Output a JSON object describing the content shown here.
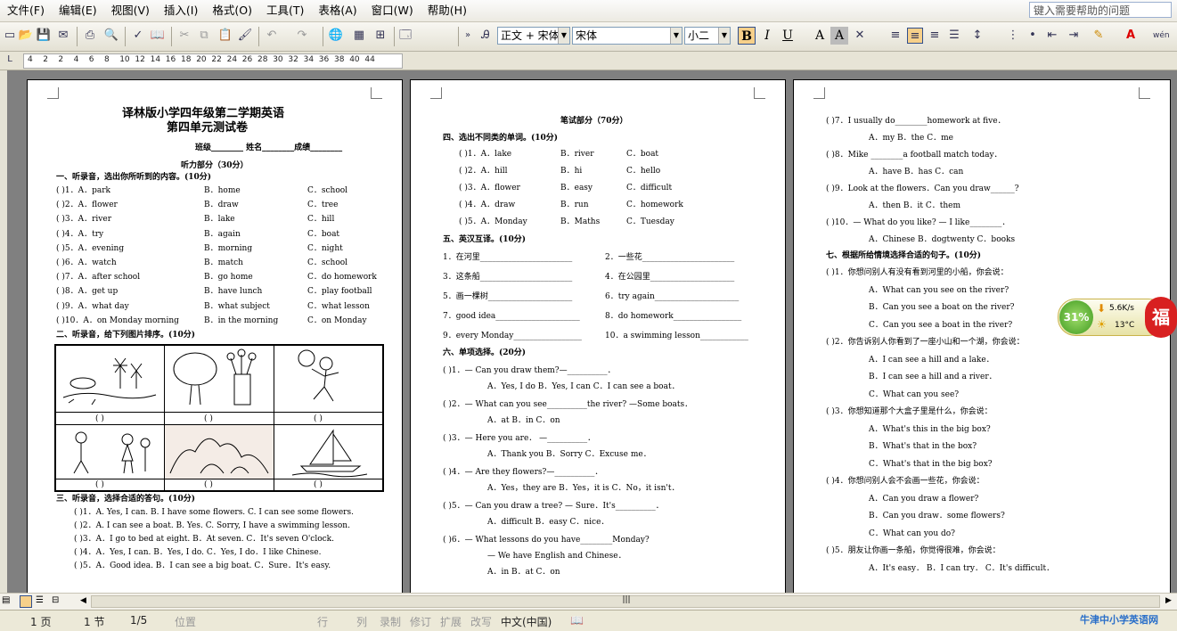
{
  "menu": [
    "文件(F)",
    "编辑(E)",
    "视图(V)",
    "插入(I)",
    "格式(O)",
    "工具(T)",
    "表格(A)",
    "窗口(W)",
    "帮助(H)"
  ],
  "help_placeholder": "键入需要帮助的问题",
  "toolbar": {
    "style_value": "正文 + 宋体",
    "font_value": "宋体",
    "size_value": "小二",
    "bold": "B",
    "italic": "I",
    "underline": "U",
    "char_a": "A",
    "char_a2": "A",
    "pinyin": "wén"
  },
  "ruler_ticks": [
    "4",
    "2",
    "2",
    "4",
    "6",
    "8",
    "10",
    "12",
    "14",
    "16",
    "18",
    "20",
    "22",
    "24",
    "26",
    "28",
    "30",
    "32",
    "34",
    "36",
    "38",
    "40",
    "44"
  ],
  "page1": {
    "title_line1": "译林版小学四年级第二学期英语",
    "title_line2": "第四单元测试卷",
    "info": "班级________ 姓名________成绩________",
    "listen_section": "听力部分（30分）",
    "sec1": "一、听录音，选出你所听到的内容。(10分)",
    "sec1_items": [
      [
        "(    )1．A．park",
        "B．home",
        "C．school"
      ],
      [
        "(    )2．A．flower",
        "B．draw",
        "C．tree"
      ],
      [
        "(    )3．A．river",
        "B．lake",
        "C．hill"
      ],
      [
        "(    )4．A．try",
        "B．again",
        "C．boat"
      ],
      [
        "(    )5．A．evening",
        "B．morning",
        "C．night"
      ],
      [
        "(    )6．A．watch",
        "B．match",
        "C．school"
      ],
      [
        "(    )7．A．after school",
        "B．go home",
        "C．do homework"
      ],
      [
        "(    )8．A．get up",
        "B．have lunch",
        "C．play football"
      ],
      [
        "(    )9．A．what day",
        "B．what subject",
        "C．what lesson"
      ],
      [
        "(    )10．A．on Monday morning",
        "B．in the morning",
        "C．on Monday"
      ]
    ],
    "sec2": "二、听录音，给下列图片排序。(10分)",
    "pic_blank": "(      )",
    "sec3": "三、听录音，选择合适的答句。(10分)",
    "sec3_items": [
      "(    )1．A. Yes, I can.      B. I have some flowers.   C.    I can see some flowers.",
      "(    )2．A. I can see a boat.    B. Yes.       C. Sorry, I have a swimming lesson.",
      "(    )3．A．I go to bed at eight.    B．At seven.    C．It's seven O'clock.",
      "(    )4．A．Yes, I can.    B．Yes, I do.    C．Yes, I do．I like Chinese.",
      "(    )5．A．Good idea.    B．I can see a big boat.    C．Sure．It's easy."
    ]
  },
  "page2": {
    "written_section": "笔试部分（70分）",
    "sec4": "四、选出不同类的单词。(10分)",
    "sec4_items": [
      [
        "(    )1．A．lake",
        "B．river",
        "C．boat"
      ],
      [
        "(    )2．A．hill",
        "B．hi",
        "C．hello"
      ],
      [
        "(    )3．A．flower",
        "B．easy",
        "C．difficult"
      ],
      [
        "(    )4．A．draw",
        "B．run",
        "C．homework"
      ],
      [
        "(    )5．A．Monday",
        "B．Maths",
        "C．Tuesday"
      ]
    ],
    "sec5": "五、英汉互译。(10分)",
    "sec5_items": [
      [
        "1．在河里_______________________",
        "2．一些花_______________________"
      ],
      [
        "3．这条船_______________________",
        "4．在公园里_____________________"
      ],
      [
        "5．画一棵树_____________________",
        "6．try again_____________________"
      ],
      [
        "7．good idea_____________________",
        "8．do homework_________________"
      ],
      [
        "9．every Monday_________________",
        "10．a swimming lesson____________"
      ]
    ],
    "sec6": "六、单项选择。(20分)",
    "sec6_items": [
      [
        "(    )1．— Can you draw them?—__________．",
        "A．Yes, I do      B．Yes, I can      C．I can see a boat．"
      ],
      [
        "(    )2．— What can you see__________the river?      —Some boats．",
        "A．at              B．in              C．on"
      ],
      [
        "(    )3．— Here you are．  —__________．",
        "A．Thank you       B．Sorry           C．Excuse me．"
      ],
      [
        "(    )4．— Are they flowers?—__________．",
        "A．Yes，they are    B．Yes，it is  C．No，it isn't．"
      ],
      [
        "(    )5．— Can you draw a tree?  — Sure．It's__________．",
        "A．difficult        B．easy            C．nice．"
      ],
      [
        "(    )6．— What lessons do you have________Monday?",
        "— We have English and Chinese．"
      ]
    ],
    "sec6_last": "A．in              B．at              C．on"
  },
  "page3": {
    "items": [
      [
        "(    )7．I usually do________homework at five．",
        "A．my          B．the          C．me"
      ],
      [
        "(    )8．Mike ________a football match today．",
        "A．have        B．has          C．can"
      ],
      [
        "(    )9．Look at the flowers．Can you draw______?",
        "A．then        B．it           C．them"
      ],
      [
        "(    )10．— What do you like?  — I like________．",
        "A．Chinese     B．dogtwenty    C．books"
      ]
    ],
    "sec7": "七、根据所给情境选择合适的句子。(10分)",
    "sec7_items": [
      [
        "(    )1．你想问别人有没有看到河里的小船，你会说：",
        "A．What can you see on the river?",
        "B．Can you see a boat on the river?",
        "C．Can you see a boat in the river?"
      ],
      [
        "(    )2．你告诉别人你看到了一座小山和一个湖，你会说：",
        "A．I can see a hill and a lake．",
        "B．I can see a hill and a river．",
        "C．What can you see?"
      ],
      [
        "(    )3．你想知道那个大盒子里是什么，你会说：",
        "A．What's this in the big box?",
        "B．What's that in the box?",
        "C．What's that in the big box?"
      ],
      [
        "(    )4．你想问别人会不会画一些花，你会说：",
        "A．Can you draw a flower?",
        "B．Can you draw．some flowers?",
        "C．What can you do?"
      ],
      [
        "(    )5．朋友让你画一条船，你觉得很难，你会说：",
        "A．It's easy．    B．I can try．    C．It's difficult．"
      ]
    ]
  },
  "widget": {
    "percent": "31%",
    "speed": "5.6K/s",
    "temp": "13°C",
    "fu": "福"
  },
  "status": {
    "page": "1 页",
    "section": "1 节",
    "pages": "1/5",
    "pos": "位置",
    "line": "行",
    "col": "列",
    "rec": "录制",
    "trk": "修订",
    "ext": "扩展",
    "ovr": "改写",
    "lang": "中文(中国)",
    "watermark": "牛津中小学英语网"
  }
}
